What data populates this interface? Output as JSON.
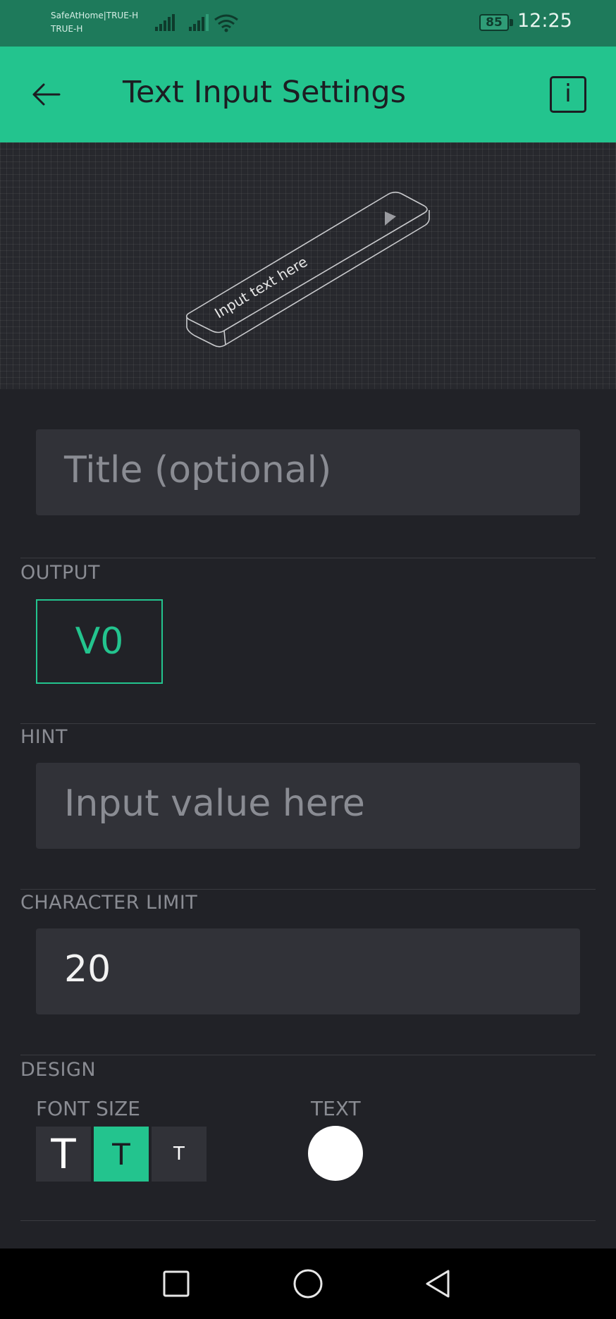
{
  "status_bar": {
    "carrier_line1": "SafeAtHome|TRUE-H",
    "carrier_line2": "TRUE-H",
    "battery": "85",
    "time": "12:25"
  },
  "app_bar": {
    "title": "Text Input Settings",
    "info_label": "i"
  },
  "preview": {
    "widget_text": "Input text here"
  },
  "title_field": {
    "placeholder": "Title (optional)",
    "value": ""
  },
  "output": {
    "label": "OUTPUT",
    "pin": "V0"
  },
  "hint": {
    "label": "HINT",
    "value": "Input value here"
  },
  "character_limit": {
    "label": "CHARACTER LIMIT",
    "value": "20"
  },
  "design": {
    "label": "DESIGN",
    "font_size_label": "FONT SIZE",
    "font_sizes": [
      {
        "glyph": "T",
        "selected": false
      },
      {
        "glyph": "T",
        "selected": true
      },
      {
        "glyph": "T",
        "selected": false
      }
    ],
    "text_label": "TEXT",
    "text_color": "#ffffff"
  },
  "colors": {
    "accent": "#23c48e",
    "background": "#212227",
    "field": "#313238"
  }
}
